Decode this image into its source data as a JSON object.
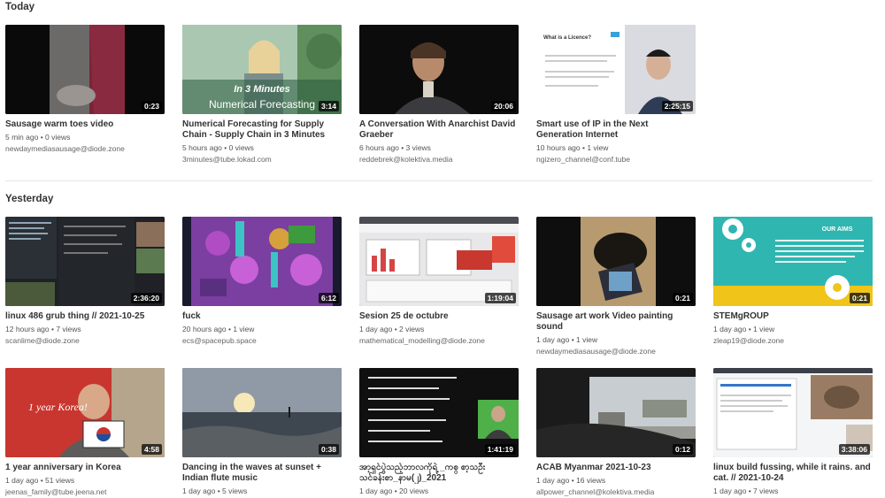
{
  "sections": {
    "today": "Today",
    "yesterday": "Yesterday"
  },
  "videos": [
    {
      "title": "Sausage warm toes video",
      "meta": "5 min ago • 0 views",
      "channel": "newdaymediasausage@diode.zone",
      "duration": "0:23"
    },
    {
      "title": "Numerical Forecasting for Supply Chain - Supply Chain in 3 Minutes",
      "meta": "5 hours ago • 0 views",
      "channel": "3minutes@tube.lokad.com",
      "duration": "3:14",
      "thumb_line1": "In 3 Minutes",
      "thumb_line2": "Numerical Forecasting"
    },
    {
      "title": "A Conversation With Anarchist David Graeber",
      "meta": "6 hours ago • 3 views",
      "channel": "reddebrek@kolektiva.media",
      "duration": "20:06"
    },
    {
      "title": "Smart use of IP in the Next Generation Internet",
      "meta": "10 hours ago • 1 view",
      "channel": "ngizero_channel@conf.tube",
      "duration": "2:25:15",
      "thumb_slide_title": "What is a Licence?"
    },
    {
      "title": "linux 486 grub thing // 2021-10-25",
      "meta": "12 hours ago • 7 views",
      "channel": "scanlime@diode.zone",
      "duration": "2:36:20"
    },
    {
      "title": "fuck",
      "meta": "20 hours ago • 1 view",
      "channel": "ecs@spacepub.space",
      "duration": "6:12"
    },
    {
      "title": "Sesion 25 de octubre",
      "meta": "1 day ago • 2 views",
      "channel": "mathematical_modelling@diode.zone",
      "duration": "1:19:04"
    },
    {
      "title": "Sausage art work Video painting sound",
      "meta": "1 day ago • 1 view",
      "channel": "newdaymediasausage@diode.zone",
      "duration": "0:21"
    },
    {
      "title": "STEMgROUP",
      "meta": "1 day ago • 1 view",
      "channel": "zleap19@diode.zone",
      "duration": "0:21",
      "thumb_heading": "OUR AIMS"
    },
    {
      "title": "1 year anniversary in Korea",
      "meta": "1 day ago • 51 views",
      "channel": "jeenas_family@tube.jeena.net",
      "duration": "4:58",
      "thumb_text": "1 year Korea!"
    },
    {
      "title": "Dancing in the waves at sunset + Indian flute music",
      "meta": "1 day ago • 5 views",
      "channel": "",
      "duration": "0:38"
    },
    {
      "title": "အာ့ရှင်ပွဲသည့်ဘာလကိုရဲ့ _ကစ္ စာ့သဦးသင်ခန်းစာ_နာမ(၂)_2021",
      "meta": "1 day ago • 20 views",
      "channel": "",
      "duration": "1:41:19"
    },
    {
      "title": "ACAB Myanmar 2021-10-23",
      "meta": "1 day ago • 16 views",
      "channel": "allpower_channel@kolektiva.media",
      "duration": "0:12"
    },
    {
      "title": "linux build fussing, while it rains. and cat. // 2021-10-24",
      "meta": "1 day ago • 7 views",
      "channel": "",
      "duration": "3:38:06"
    }
  ],
  "colors": {
    "accent": "#f1680d",
    "text": "#333333",
    "muted": "#666666"
  }
}
